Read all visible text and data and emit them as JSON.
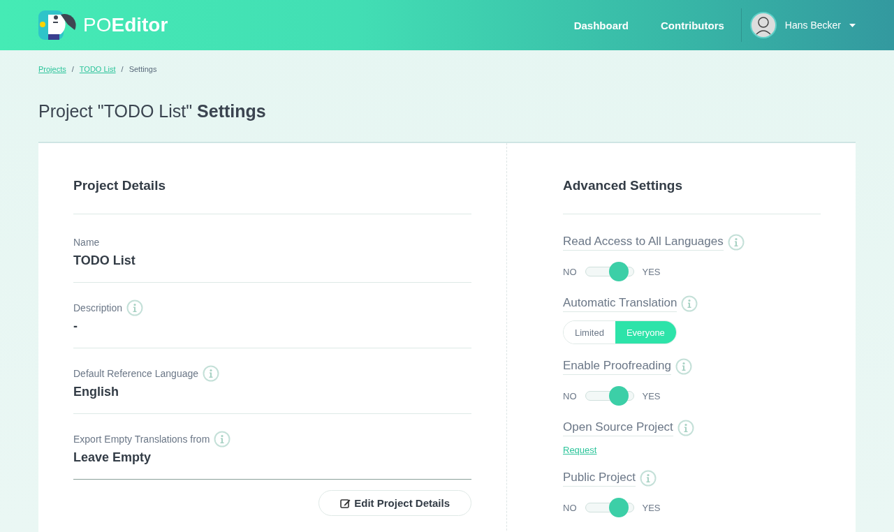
{
  "header": {
    "logo": {
      "light": "PO",
      "bold": "Editor"
    },
    "nav": [
      {
        "label": "Dashboard"
      },
      {
        "label": "Contributors"
      }
    ],
    "user": {
      "name": "Hans Becker"
    }
  },
  "breadcrumb": [
    {
      "label": "Projects",
      "link": true
    },
    {
      "label": "TODO List",
      "link": true
    },
    {
      "label": "Settings",
      "link": false
    }
  ],
  "breadcrumb_separator": "/",
  "page_title": "Project \"TODO List\" **Settings**",
  "details": {
    "title": "Project Details",
    "fields": [
      {
        "label": "Name",
        "value": "TODO List",
        "info": false
      },
      {
        "label": "Description",
        "value": "-",
        "info": true
      },
      {
        "label": "Default Reference Language",
        "value": "English",
        "info": true
      },
      {
        "label": "Export Empty Translations from",
        "value": "Leave Empty",
        "info": true
      }
    ],
    "edit_button": "Edit Project Details"
  },
  "advanced": {
    "title": "Advanced Settings",
    "settings": [
      {
        "kind": "toggle",
        "label": "Read Access to All Languages",
        "off_label": "NO",
        "on_label": "YES",
        "on": true
      },
      {
        "kind": "segmented",
        "label": "Automatic Translation",
        "options": [
          {
            "label": "Limited",
            "selected": false
          },
          {
            "label": "Everyone",
            "selected": true
          }
        ]
      },
      {
        "kind": "toggle",
        "label": "Enable Proofreading",
        "off_label": "NO",
        "on_label": "YES",
        "on": true
      },
      {
        "kind": "link",
        "label": "Open Source Project",
        "link": "Request"
      },
      {
        "kind": "toggle",
        "label": "Public Project",
        "off_label": "NO",
        "on_label": "YES",
        "on": true
      }
    ]
  }
}
